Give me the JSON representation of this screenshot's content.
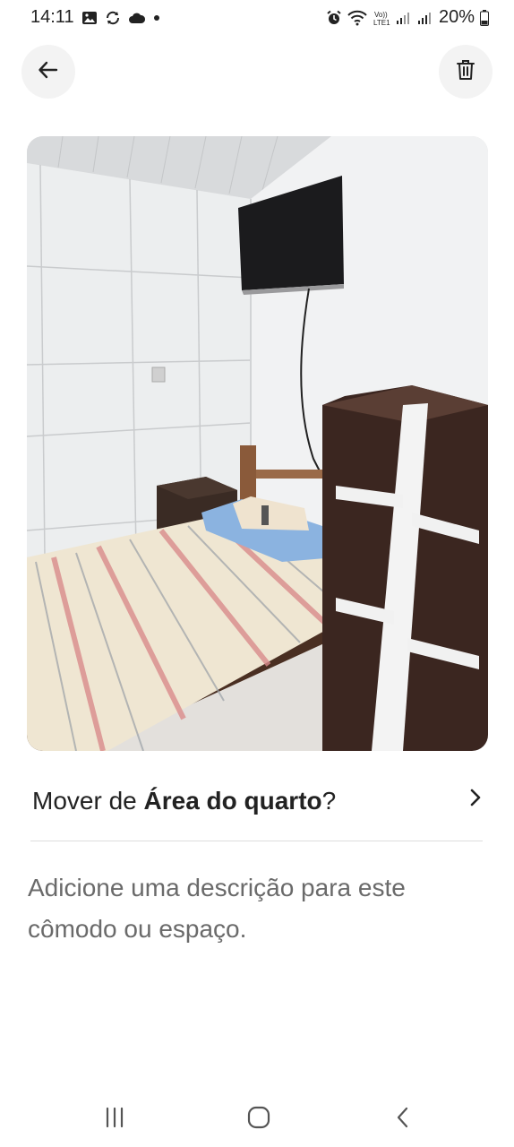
{
  "status_bar": {
    "time": "14:11",
    "battery": "20%",
    "left_icons": [
      "gallery-icon",
      "sync-icon",
      "cloud-icon",
      "dot-icon"
    ],
    "right_icons": [
      "alarm-icon",
      "wifi-icon",
      "volte-icon",
      "signal-icon",
      "signal-icon",
      "battery-icon"
    ],
    "volte_label": "Vo))\nLTE1"
  },
  "header": {
    "back_icon": "arrow-left-icon",
    "delete_icon": "trash-icon"
  },
  "photo": {
    "description": "bedroom-photo"
  },
  "move_row": {
    "prefix": "Mover de ",
    "room_name": "Área do quarto",
    "suffix": "?",
    "icon": "chevron-right-icon"
  },
  "description_placeholder": "Adicione uma descrição para este cômodo ou espaço.",
  "nav": {
    "recent_icon": "recent-apps-icon",
    "home_icon": "home-icon",
    "back_icon": "back-chevron-icon"
  },
  "colors": {
    "text": "#222222",
    "muted": "#6a6a6a",
    "button_bg": "#f3f3f3",
    "divider": "#dddddd"
  }
}
